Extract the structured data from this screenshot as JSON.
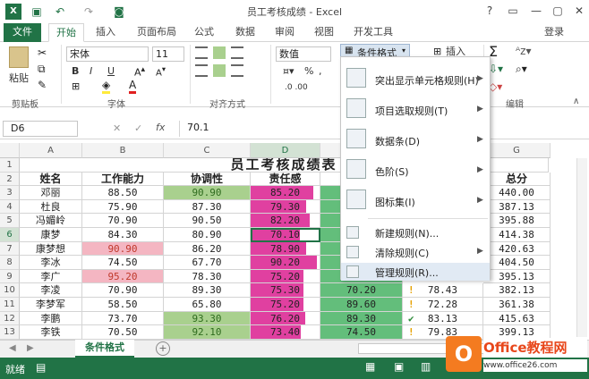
{
  "app": {
    "title": "员工考核成绩 - Excel",
    "signin": "登录"
  },
  "tabs": [
    "文件",
    "开始",
    "插入",
    "页面布局",
    "公式",
    "数据",
    "审阅",
    "视图",
    "开发工具"
  ],
  "ribbon": {
    "paste": "粘贴",
    "font_name": "宋体",
    "font_size": "11",
    "number_format": "数值",
    "bold": "B",
    "italic": "I",
    "underline": "U",
    "currency": "%",
    "comma": ",",
    "cond_format": "条件格式",
    "insert": "插入",
    "sum": "Σ",
    "groups": {
      "clipboard": "剪贴板",
      "font": "字体",
      "align": "对齐方式",
      "edit": "编辑"
    }
  },
  "formula": {
    "namebox": "D6",
    "fx": "fx",
    "value": "70.1",
    "cancel": "✕",
    "enter": "✓"
  },
  "columns": [
    "A",
    "B",
    "C",
    "D",
    "E",
    "F",
    "G"
  ],
  "rows": [
    "1",
    "2",
    "3",
    "4",
    "5",
    "6",
    "7",
    "8",
    "9",
    "10",
    "11",
    "12",
    "13"
  ],
  "sheet_title": "员工考核成绩表",
  "headers": [
    "姓名",
    "工作能力",
    "协调性",
    "责任感",
    "",
    "",
    "总分"
  ],
  "table": [
    [
      "邓丽",
      "88.50",
      "90.90",
      "85.20",
      "440.00"
    ],
    [
      "杜良",
      "75.90",
      "87.30",
      "79.30",
      "387.13"
    ],
    [
      "冯媚岭",
      "70.90",
      "90.50",
      "82.20",
      "395.88"
    ],
    [
      "康梦",
      "84.30",
      "80.90",
      "70.10",
      "414.38"
    ],
    [
      "康梦想",
      "90.90",
      "86.20",
      "78.90",
      "420.63"
    ],
    [
      "李冰",
      "74.50",
      "67.70",
      "90.20",
      "404.50"
    ],
    [
      "李广",
      "95.20",
      "78.30",
      "75.20",
      "395.13"
    ],
    [
      "李凌",
      "70.90",
      "89.30",
      "75.30",
      "382.13"
    ],
    [
      "李梦军",
      "58.50",
      "65.80",
      "75.20",
      "361.38"
    ],
    [
      "李鹏",
      "73.70",
      "93.30",
      "76.20",
      "415.63"
    ],
    [
      "李铁",
      "70.50",
      "92.10",
      "73.40",
      "399.13"
    ]
  ],
  "col_e": {
    "r10": "70.20",
    "r11": "89.60",
    "r12": "89.30",
    "r13": "74.50"
  },
  "col_f": {
    "r10": "78.43",
    "r11": "72.28",
    "r12": "83.13",
    "r13": "79.83"
  },
  "menu": [
    {
      "label": "突出显示单元格规则(H)",
      "arrow": "▶"
    },
    {
      "label": "项目选取规则(T)",
      "arrow": "▶"
    },
    {
      "label": "数据条(D)",
      "arrow": "▶"
    },
    {
      "label": "色阶(S)",
      "arrow": "▶"
    },
    {
      "label": "图标集(I)",
      "arrow": "▶"
    },
    {
      "label": "新建规则(N)..."
    },
    {
      "label": "清除规则(C)",
      "arrow": "▶"
    },
    {
      "label": "管理规则(R)..."
    }
  ],
  "sheet_tab": "条件格式",
  "status": "就绪",
  "watermark": {
    "name": "Office教程网",
    "url": "www.office26.com"
  },
  "colors": {
    "accent": "#217346",
    "green": "#a9d08e",
    "pink": "#f4b6c2",
    "magenta": "#e040a0"
  }
}
